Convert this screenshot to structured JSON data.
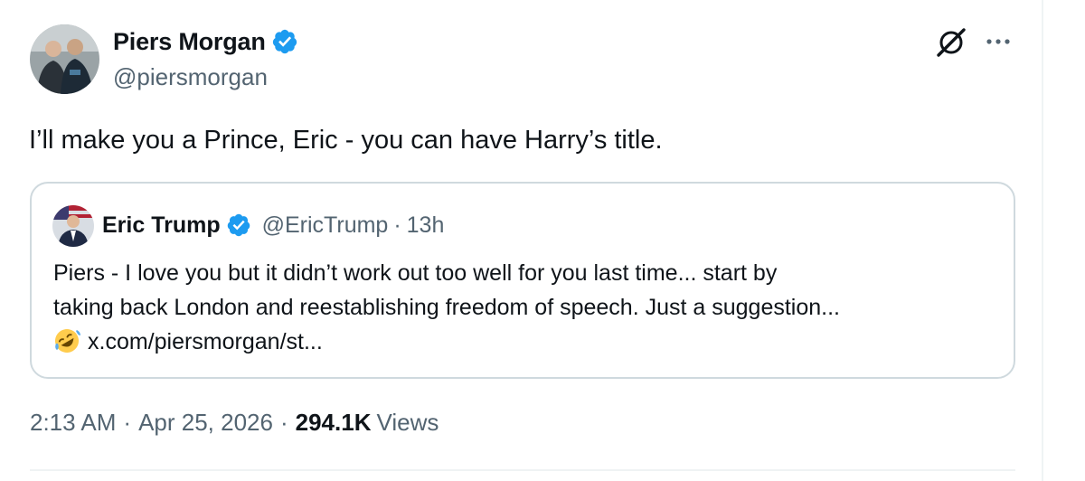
{
  "author": {
    "display_name": "Piers Morgan",
    "handle": "@piersmorgan",
    "verified": true
  },
  "actions": {
    "grok_icon": "grok-icon",
    "more_icon": "more-horizontal-icon"
  },
  "tweet": {
    "text": "I’ll make you a Prince, Eric - you can have Harry’s title."
  },
  "quote": {
    "display_name": "Eric Trump",
    "handle": "@EricTrump",
    "separator": "·",
    "time": "13h",
    "lines": [
      "Piers - I love you but it didn’t work out too well for you last time... start by",
      "taking back London and reestablishing freedom of speech. Just a suggestion..."
    ],
    "emoji_icon": "rolling-on-floor-laughing-emoji",
    "link": "x.com/piersmorgan/st..."
  },
  "meta": {
    "time": "2:13 AM",
    "separator": "·",
    "date": "Apr 25, 2026",
    "views_count": "294.1K",
    "views_label": "Views"
  },
  "colors": {
    "text": "#0f1419",
    "secondary": "#536471",
    "verified_blue": "#1d9bf0",
    "border": "#cfd9de"
  }
}
